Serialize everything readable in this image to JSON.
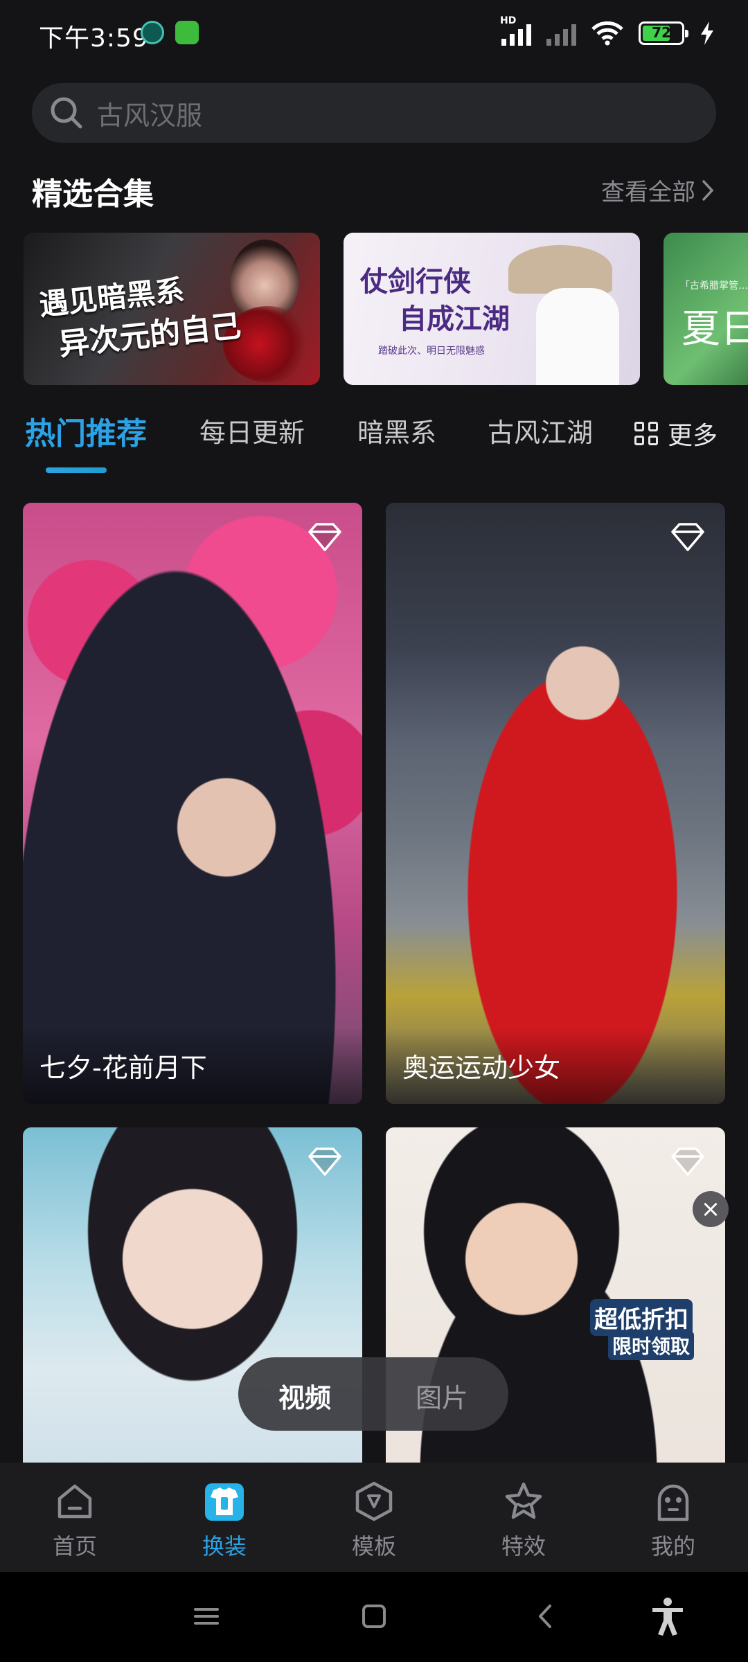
{
  "status_bar": {
    "time": "下午3:59",
    "network_badge": "HD",
    "battery_percent": "72",
    "battery_level": 0.72
  },
  "search": {
    "placeholder": "古风汉服",
    "icon": "search-icon"
  },
  "featured": {
    "title": "精选合集",
    "see_all": "查看全部",
    "banners": [
      {
        "line1": "遇见暗黑系",
        "line2": "异次元的自己"
      },
      {
        "line1": "仗剑行侠",
        "line2": "自成江湖",
        "subtitle": "踏破此次、明日无限魅惑"
      },
      {
        "tag": "「古希腊掌管…",
        "text": "夏日"
      }
    ]
  },
  "tabs": {
    "items": [
      "热门推荐",
      "每日更新",
      "暗黑系",
      "古风江湖"
    ],
    "active_index": 0,
    "more_label": "更多"
  },
  "cards": [
    {
      "title": "七夕-花前月下"
    },
    {
      "title": "奥运运动少女"
    },
    {
      "title": ""
    },
    {
      "title": ""
    }
  ],
  "promo": {
    "line1": "超低折扣",
    "line2": "限时领取",
    "close": "×"
  },
  "media_switch": {
    "options": [
      "视频",
      "图片"
    ],
    "active": "视频"
  },
  "bottom_nav": {
    "items": [
      {
        "label": "首页",
        "icon": "home-icon"
      },
      {
        "label": "换装",
        "icon": "shirt-icon"
      },
      {
        "label": "模板",
        "icon": "template-icon"
      },
      {
        "label": "特效",
        "icon": "star-icon"
      },
      {
        "label": "我的",
        "icon": "profile-icon"
      }
    ],
    "active_index": 1
  },
  "colors": {
    "accent": "#2CA3E6",
    "background": "#141416",
    "nav_background": "#1C1C1F"
  }
}
